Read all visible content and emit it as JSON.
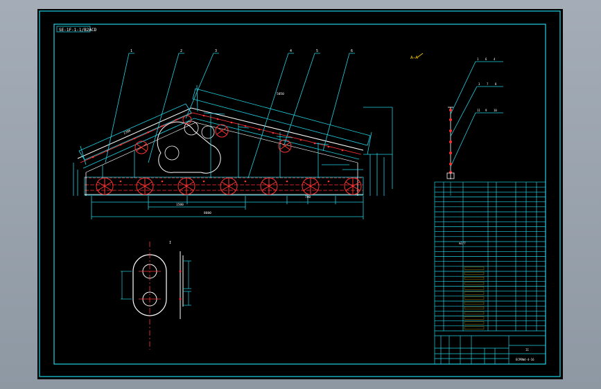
{
  "drawing": {
    "title_tag": "SE-1F-1-1/B2ACD",
    "bom_callouts": [
      "1",
      "2",
      "3",
      "4",
      "5",
      "6"
    ],
    "chain_callouts": [
      [
        "1",
        "6",
        "4"
      ],
      [
        "3",
        "7",
        "8"
      ],
      [
        "11",
        "9",
        "10"
      ]
    ],
    "detail_label": "I",
    "dim_labels": {
      "overall_length": "8600",
      "slope_length": "5050",
      "mid_span": "1500",
      "left_rise": "2380",
      "gap": "780"
    },
    "table_mark": "m2/7",
    "title_block": {
      "drawing_number": "ECPBW4-4-16",
      "sheet_mark": "II"
    }
  }
}
